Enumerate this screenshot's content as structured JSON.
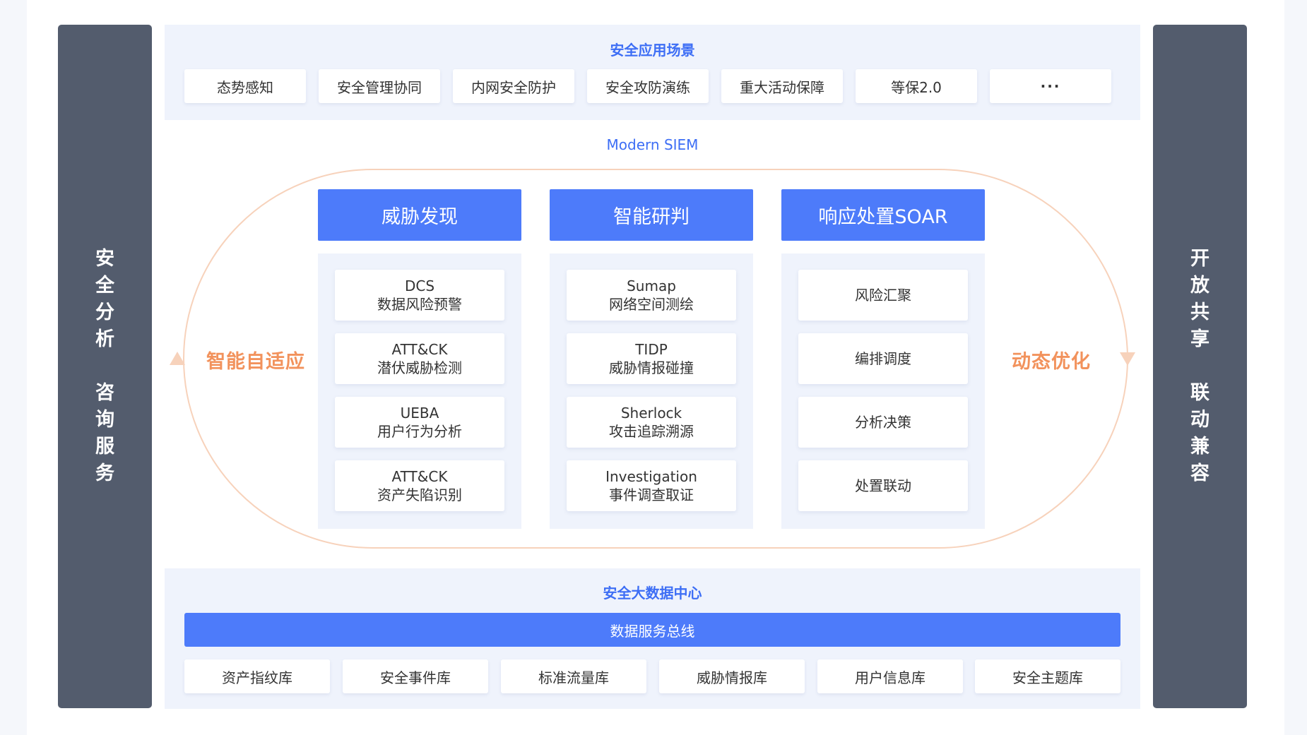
{
  "left_bar": {
    "chars": [
      "安",
      "全",
      "分",
      "析",
      "",
      "咨",
      "询",
      "服",
      "务"
    ]
  },
  "right_bar": {
    "chars": [
      "开",
      "放",
      "共",
      "享",
      "",
      "联",
      "动",
      "兼",
      "容"
    ]
  },
  "application_layer": {
    "title": "安全应用场景",
    "items": [
      "态势感知",
      "安全管理协同",
      "内网安全防护",
      "安全攻防演练",
      "重大活动保障",
      "等保2.0",
      "···"
    ]
  },
  "siem": {
    "title": "Modern SIEM",
    "loop_left_label": "智能自适应",
    "loop_right_label": "动态优化",
    "loop_color": "#f2925c",
    "columns": [
      {
        "header": "威胁发现",
        "cards": [
          {
            "line1": "DCS",
            "line2": "数据风险预警"
          },
          {
            "line1": "ATT&CK",
            "line2": "潜伏威胁检测"
          },
          {
            "line1": "UEBA",
            "line2": "用户行为分析"
          },
          {
            "line1": "ATT&CK",
            "line2": "资产失陷识别"
          }
        ]
      },
      {
        "header": "智能研判",
        "cards": [
          {
            "line1": "Sumap",
            "line2": "网络空间测绘"
          },
          {
            "line1": "TIDP",
            "line2": "威胁情报碰撞"
          },
          {
            "line1": "Sherlock",
            "line2": "攻击追踪溯源"
          },
          {
            "line1": "Investigation",
            "line2": "事件调查取证"
          }
        ]
      },
      {
        "header": "响应处置SOAR",
        "cards": [
          {
            "line1": "风险汇聚",
            "line2": ""
          },
          {
            "line1": "编排调度",
            "line2": ""
          },
          {
            "line1": "分析决策",
            "line2": ""
          },
          {
            "line1": "处置联动",
            "line2": ""
          }
        ]
      }
    ]
  },
  "data_center": {
    "title": "安全大数据中心",
    "bus_label": "数据服务总线",
    "items": [
      "资产指纹库",
      "安全事件库",
      "标准流量库",
      "威胁情报库",
      "用户信息库",
      "安全主题库"
    ]
  },
  "colors": {
    "accent": "#4d7bfa",
    "title_blue": "#3d6ef5",
    "side_bar": "#535c6d",
    "panel_bg": "#eff3fc"
  }
}
